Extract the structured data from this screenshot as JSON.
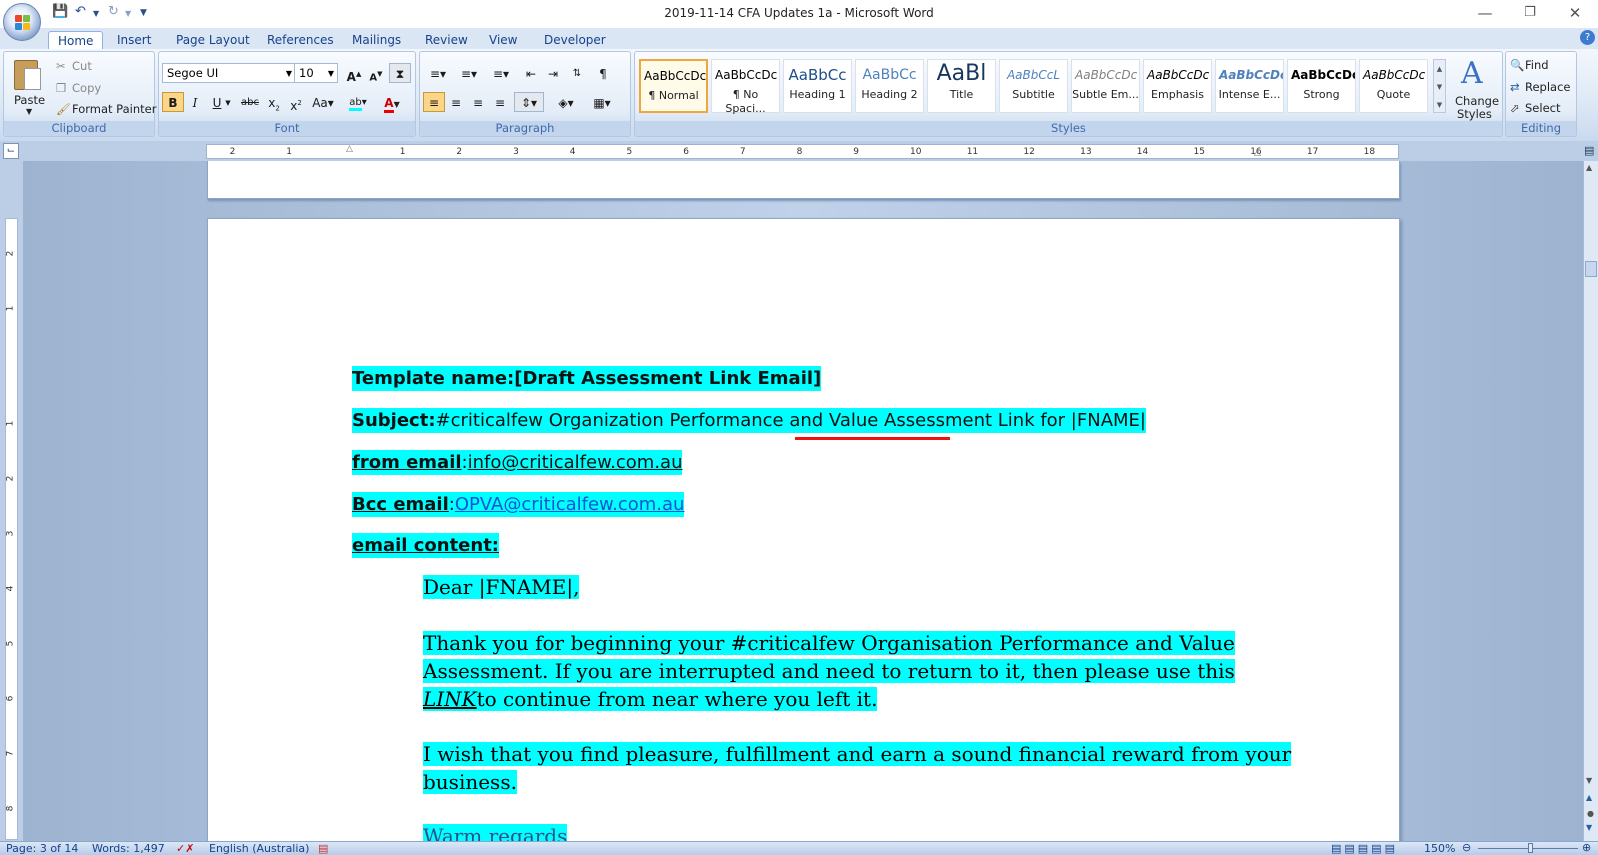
{
  "window": {
    "title": "2019-11-14 CFA Updates 1a - Microsoft Word"
  },
  "tabs": [
    "Home",
    "Insert",
    "Page Layout",
    "References",
    "Mailings",
    "Review",
    "View",
    "Developer"
  ],
  "clipboard": {
    "paste": "Paste",
    "cut": "Cut",
    "copy": "Copy",
    "format_painter": "Format Painter",
    "label": "Clipboard"
  },
  "font": {
    "family": "Segoe UI",
    "size": "10",
    "label": "Font"
  },
  "paragraph": {
    "label": "Paragraph"
  },
  "styles": {
    "label": "Styles",
    "items": [
      {
        "preview": "AaBbCcDc",
        "name": "¶ Normal"
      },
      {
        "preview": "AaBbCcDc",
        "name": "¶ No Spaci..."
      },
      {
        "preview": "AaBbCc",
        "name": "Heading 1"
      },
      {
        "preview": "AaBbCc",
        "name": "Heading 2"
      },
      {
        "preview": "AaBl",
        "name": "Title"
      },
      {
        "preview": "AaBbCcL",
        "name": "Subtitle"
      },
      {
        "preview": "AaBbCcDc",
        "name": "Subtle Em..."
      },
      {
        "preview": "AaBbCcDc",
        "name": "Emphasis"
      },
      {
        "preview": "AaBbCcDc",
        "name": "Intense E..."
      },
      {
        "preview": "AaBbCcDc",
        "name": "Strong"
      },
      {
        "preview": "AaBbCcDc",
        "name": "Quote"
      }
    ],
    "change_styles_1": "Change",
    "change_styles_2": "Styles"
  },
  "editing": {
    "find": "Find",
    "replace": "Replace",
    "select": "Select",
    "label": "Editing"
  },
  "ruler_numbers": [
    "2",
    "1",
    "1",
    "2",
    "3",
    "4",
    "5",
    "6",
    "7",
    "8",
    "9",
    "10",
    "11",
    "12",
    "13",
    "14",
    "15",
    "16",
    "17",
    "18"
  ],
  "vruler_numbers": [
    "2",
    "1",
    "1",
    "2",
    "3",
    "4",
    "5",
    "6",
    "7",
    "8"
  ],
  "document": {
    "template_label": "Template name:",
    "template_value": "[Draft Assessment Link Email]",
    "subject_label": "Subject:",
    "subject_value": "#criticalfew Organization Performance and Value Assessment Link for |FNAME|",
    "from_label": "from email",
    "from_sep": ":",
    "from_value": "info@criticalfew.com.au",
    "bcc_label": "Bcc email",
    "bcc_sep": ":",
    "bcc_value": "OPVA@criticalfew.com.au",
    "content_label": "email content:",
    "greeting": "Dear |FNAME|,",
    "para1_line1": "Thank you for beginning your #criticalfew Organisation Performance and Value",
    "para1_line2": "Assessment. If you are interrupted and need to return to it, then please use this",
    "para1_link": "LINK",
    "para1_line3": "to continue from near where you left it.",
    "para2_line1": "I wish that you find pleasure, fulfillment and earn a sound financial reward from your",
    "para2_line2": "business.",
    "signoff": "Warm regards"
  },
  "status": {
    "page": "Page: 3 of 14",
    "words": "Words: 1,497",
    "language": "English (Australia)",
    "zoom": "150%"
  }
}
